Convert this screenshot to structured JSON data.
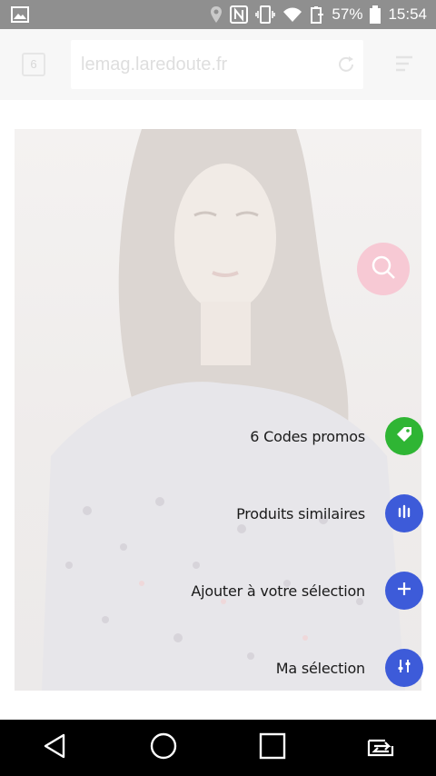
{
  "status_bar": {
    "battery_percent": "57%",
    "time": "15:54",
    "icons": [
      "gallery-icon",
      "location-icon",
      "nfc-icon",
      "vibrate-icon",
      "wifi-icon",
      "battery-saver-icon",
      "battery-icon"
    ]
  },
  "browser": {
    "tab_count": "6",
    "url": "lemag.laredoute.fr"
  },
  "actions": [
    {
      "label": "6 Codes promos",
      "icon": "tag-icon",
      "color": "#2fb534"
    },
    {
      "label": "Produits similaires",
      "icon": "bars-icon",
      "color": "#3d5bd9"
    },
    {
      "label": "Ajouter à votre sélection",
      "icon": "plus-icon",
      "color": "#3d5bd9"
    },
    {
      "label": "Ma sélection",
      "icon": "sliders-icon",
      "color": "#3d5bd9"
    }
  ],
  "search_fab_color": "#f7c9d4",
  "nav": [
    "back-icon",
    "home-icon",
    "recents-icon",
    "switch-app-icon"
  ]
}
